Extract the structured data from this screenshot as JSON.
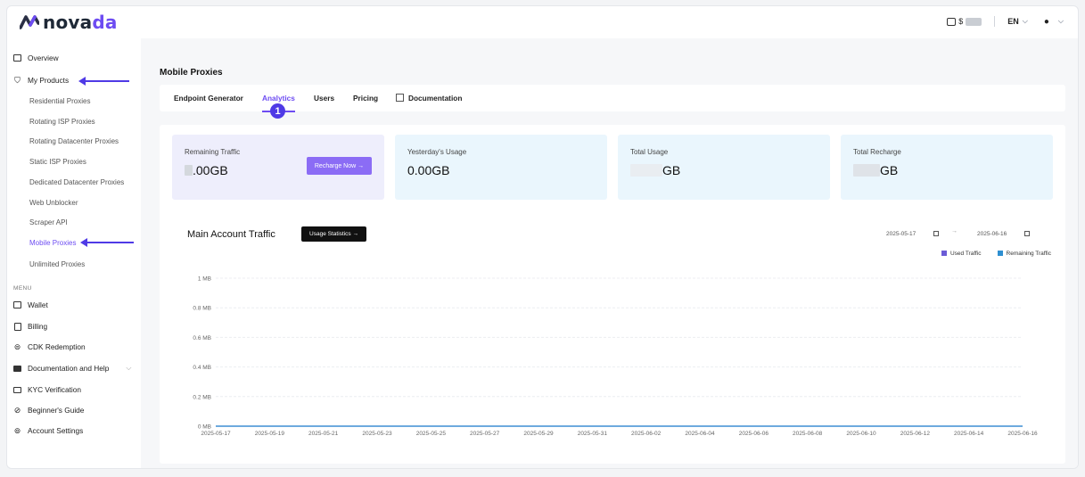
{
  "brand": {
    "name_left": "nova",
    "name_right": "da"
  },
  "header": {
    "balance_prefix": "$",
    "language": "EN"
  },
  "sidebar": {
    "overview": "Overview",
    "my_products": "My Products",
    "products": [
      "Residential Proxies",
      "Rotating ISP Proxies",
      "Rotating Datacenter Proxies",
      "Static ISP Proxies",
      "Dedicated Datacenter Proxies",
      "Web Unblocker",
      "Scraper API",
      "Mobile Proxies",
      "Unlimited Proxies"
    ],
    "active_product": "Mobile Proxies",
    "menu_label": "MENU",
    "menu": [
      "Wallet",
      "Billing",
      "CDK Redemption",
      "Documentation and Help",
      "KYC Verification",
      "Beginner's Guide",
      "Account Settings"
    ]
  },
  "page": {
    "title": "Mobile Proxies",
    "tabs": [
      "Endpoint Generator",
      "Analytics",
      "Users",
      "Pricing",
      "Documentation"
    ],
    "active_tab": "Analytics",
    "step_badge": "1"
  },
  "cards": [
    {
      "label": "Remaining Traffic",
      "value_suffix": ".00GB",
      "button": "Recharge Now →"
    },
    {
      "label": "Yesterday's Usage",
      "value": "0.00GB"
    },
    {
      "label": "Total Usage",
      "value_suffix": "GB"
    },
    {
      "label": "Total Recharge",
      "value_suffix": "GB"
    }
  ],
  "traffic": {
    "title": "Main Account Traffic",
    "stats_button": "Usage Statistics →",
    "date_start": "2025-05-17",
    "date_sep": "→",
    "date_end": "2025-06-16"
  },
  "colors": {
    "accent": "#6d4cf2",
    "used": "#6b5bd6",
    "remaining": "#2e8fd1"
  },
  "chart_data": {
    "type": "line",
    "x": [
      "2025-05-17",
      "2025-05-18",
      "2025-05-19",
      "2025-05-20",
      "2025-05-21",
      "2025-05-22",
      "2025-05-23",
      "2025-05-24",
      "2025-05-25",
      "2025-05-26",
      "2025-05-27",
      "2025-05-28",
      "2025-05-29",
      "2025-05-30",
      "2025-05-31",
      "2025-06-01",
      "2025-06-02",
      "2025-06-03",
      "2025-06-04",
      "2025-06-05",
      "2025-06-06",
      "2025-06-07",
      "2025-06-08",
      "2025-06-09",
      "2025-06-10",
      "2025-06-11",
      "2025-06-12",
      "2025-06-13",
      "2025-06-14",
      "2025-06-15",
      "2025-06-16"
    ],
    "x_tick_labels": [
      "2025-05-17",
      "2025-05-19",
      "2025-05-21",
      "2025-05-23",
      "2025-05-25",
      "2025-05-27",
      "2025-05-29",
      "2025-05-31",
      "2025-06-02",
      "2025-06-04",
      "2025-06-06",
      "2025-06-08",
      "2025-06-10",
      "2025-06-12",
      "2025-06-14",
      "2025-06-16"
    ],
    "y_ticks": [
      "0 MB",
      "0.2 MB",
      "0.4 MB",
      "0.6 MB",
      "0.8 MB",
      "1 MB"
    ],
    "ylim": [
      0,
      1
    ],
    "series": [
      {
        "name": "Used Traffic",
        "values": [
          0,
          0,
          0,
          0,
          0,
          0,
          0,
          0,
          0,
          0,
          0,
          0,
          0,
          0,
          0,
          0,
          0,
          0,
          0,
          0,
          0,
          0,
          0,
          0,
          0,
          0,
          0,
          0,
          0,
          0,
          0
        ]
      },
      {
        "name": "Remaining Traffic",
        "values": [
          0,
          0,
          0,
          0,
          0,
          0,
          0,
          0,
          0,
          0,
          0,
          0,
          0,
          0,
          0,
          0,
          0,
          0,
          0,
          0,
          0,
          0,
          0,
          0,
          0,
          0,
          0,
          0,
          0,
          0,
          0
        ]
      }
    ],
    "legend": "top-right",
    "grid": true
  }
}
